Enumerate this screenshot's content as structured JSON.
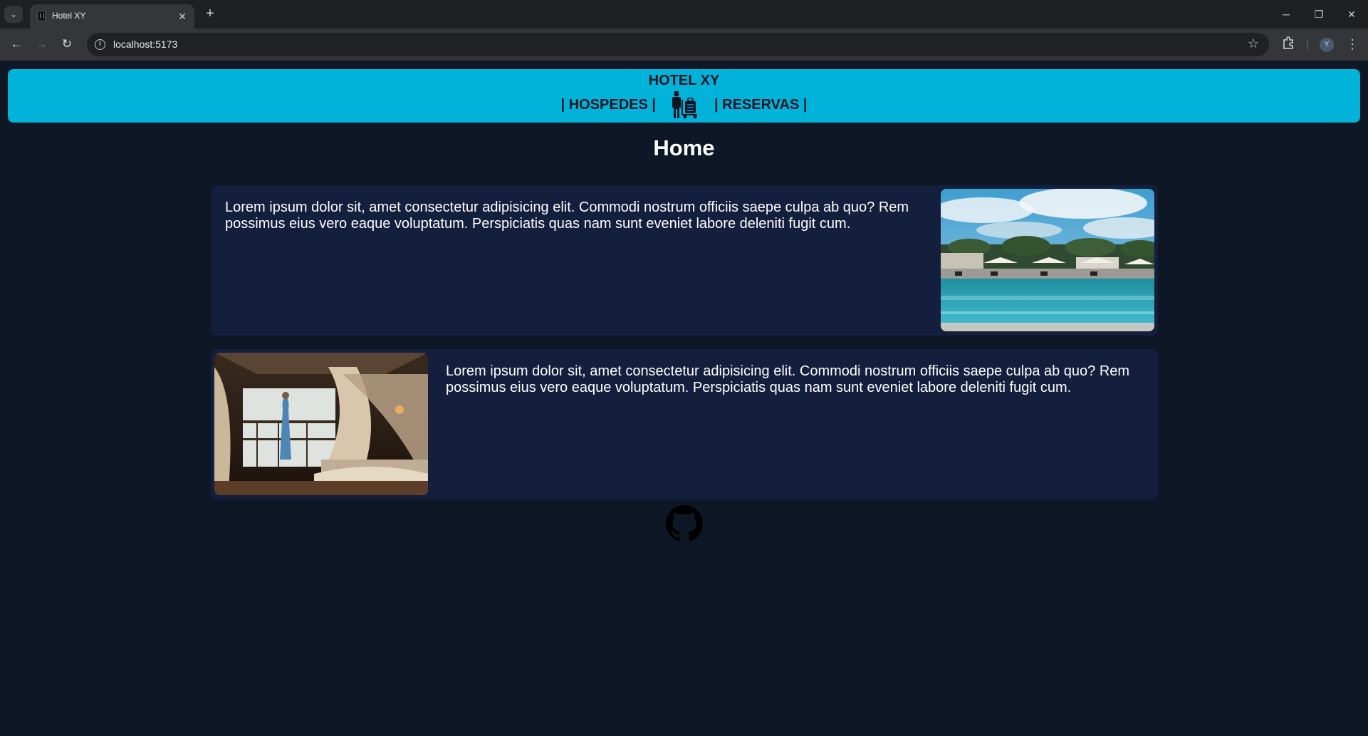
{
  "browser": {
    "tab_title": "Hotel XY",
    "url": "localhost:5173",
    "profile_initial": "Y"
  },
  "site": {
    "title": "HOTEL XY",
    "nav": {
      "guests_label": "| HOSPEDES |",
      "reservations_label": "| RESERVAS |"
    },
    "page_title": "Home",
    "cards": [
      {
        "text": "Lorem ipsum dolor sit, amet consectetur adipisicing elit. Commodi nostrum officiis saepe culpa ab quo? Rem possimus eius vero eaque voluptatum. Perspiciatis quas nam sunt eveniet labore deleniti fugit cum."
      },
      {
        "text": "Lorem ipsum dolor sit, amet consectetur adipisicing elit. Commodi nostrum officiis saepe culpa ab quo? Rem possimus eius vero eaque voluptatum. Perspiciatis quas nam sunt eveniet labore deleniti fugit cum."
      }
    ]
  },
  "colors": {
    "header_bg": "#01b3d9",
    "page_bg": "#0d1726",
    "card_bg": "#131f3d"
  },
  "icons": {
    "bellhop": "bellhop-luggage-icon",
    "footer": "github-icon"
  }
}
